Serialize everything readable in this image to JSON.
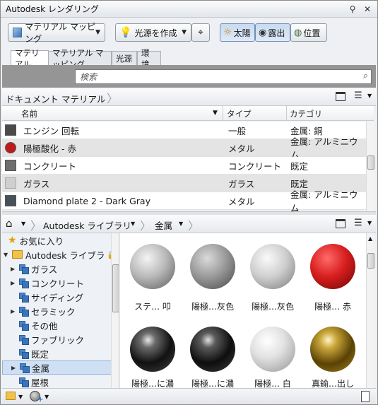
{
  "window": {
    "title": "Autodesk レンダリング"
  },
  "toolbar": {
    "material_mapping_label": "マテリアル マッピング",
    "create_light_label": "光源を作成",
    "sun_label": "太陽",
    "exposure_label": "露出",
    "location_label": "位置"
  },
  "tabs": [
    "マテリアル",
    "マテリアル マッピング",
    "光源",
    "環境"
  ],
  "search": {
    "placeholder": "検索"
  },
  "document_materials": {
    "header": "ドキュメント マテリアル",
    "columns": {
      "name": "名前",
      "type": "タイプ",
      "category": "カテゴリ"
    },
    "rows": [
      {
        "name": "エンジン 回転",
        "type": "一般",
        "category": "金属: 銅",
        "swatch": "#4a4a4a"
      },
      {
        "name": "陽極酸化 - 赤",
        "type": "メタル",
        "category": "金属: アルミニウム",
        "swatch": "#c0191b"
      },
      {
        "name": "コンクリート",
        "type": "コンクリート",
        "category": "既定",
        "swatch": "#6e6e6e"
      },
      {
        "name": "ガラス",
        "type": "ガラス",
        "category": "既定",
        "swatch": "#cfcfcf"
      },
      {
        "name": "Diamond plate 2 - Dark Gray",
        "type": "メタル",
        "category": "金属: アルミニウム",
        "swatch": "#46505a"
      }
    ]
  },
  "library": {
    "breadcrumb": [
      "Autodesk ライブラリ",
      "金属"
    ],
    "tree": [
      {
        "label": "お気に入り",
        "icon": "star-icon",
        "expander": ""
      },
      {
        "label": "Autodesk ライブラ",
        "icon": "folder-icon",
        "expander": "▼",
        "locked": true
      },
      {
        "label": "ガラス",
        "icon": "category-icon",
        "expander": "▶"
      },
      {
        "label": "コンクリート",
        "icon": "category-icon",
        "expander": "▶"
      },
      {
        "label": "サイディング",
        "icon": "category-icon",
        "expander": ""
      },
      {
        "label": "セラミック",
        "icon": "category-icon",
        "expander": "▶"
      },
      {
        "label": "その他",
        "icon": "category-icon",
        "expander": ""
      },
      {
        "label": "ファブリック",
        "icon": "category-icon",
        "expander": ""
      },
      {
        "label": "既定",
        "icon": "category-icon",
        "expander": ""
      },
      {
        "label": "金属",
        "icon": "category-icon",
        "expander": "▶",
        "selected": true
      },
      {
        "label": "屋根",
        "icon": "category-icon",
        "expander": ""
      }
    ],
    "materials": [
      {
        "label": "ステ… 叩",
        "color": "gray-rough"
      },
      {
        "label": "陽極…灰色",
        "color": "gray-matte"
      },
      {
        "label": "陽極…灰色",
        "color": "light-gray"
      },
      {
        "label": "陽極… 赤",
        "color": "red"
      },
      {
        "label": "陽極…に濃",
        "color": "black-gloss"
      },
      {
        "label": "陽極…に濃",
        "color": "black-gloss"
      },
      {
        "label": "陽極… 白",
        "color": "white-rough"
      },
      {
        "label": "真鍮…出し",
        "color": "brass"
      }
    ]
  }
}
